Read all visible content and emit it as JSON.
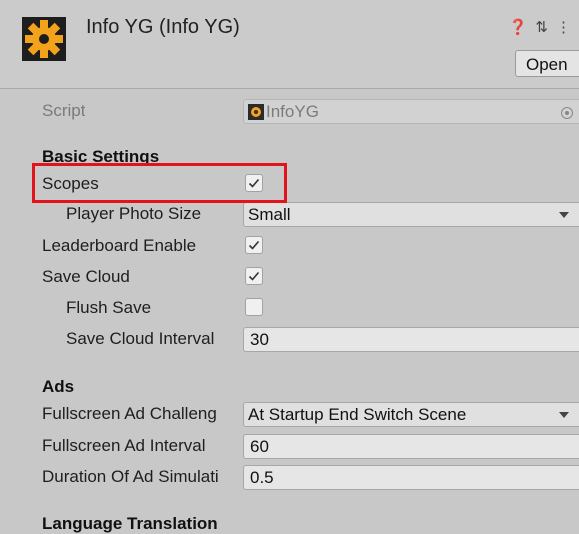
{
  "header": {
    "title": "Info YG (Info YG)",
    "open_label": "Open",
    "help_icon": "help-icon",
    "settings_icon": "settings-sliders-icon",
    "menu_icon": "kebab-menu-icon",
    "accent_color": "#f2a21b"
  },
  "script": {
    "label": "Script",
    "value": "InfoYG"
  },
  "basic": {
    "heading": "Basic Settings",
    "scopes_label": "Scopes",
    "scopes_checked": true,
    "photo_size_label": "Player Photo Size",
    "photo_size_value": "Small",
    "leaderboard_label": "Leaderboard Enable",
    "leaderboard_checked": true,
    "save_cloud_label": "Save Cloud",
    "save_cloud_checked": true,
    "flush_save_label": "Flush Save",
    "flush_save_checked": false,
    "save_interval_label": "Save Cloud Interval",
    "save_interval_value": "30"
  },
  "ads": {
    "heading": "Ads",
    "challenge_label": "Fullscreen Ad Challeng",
    "challenge_value": "At Startup End Switch Scene",
    "interval_label": "Fullscreen Ad Interval",
    "interval_value": "60",
    "duration_label": "Duration Of Ad Simulati",
    "duration_value": "0.5"
  },
  "language": {
    "heading": "Language Translation"
  },
  "highlight_color": "#e0141a"
}
